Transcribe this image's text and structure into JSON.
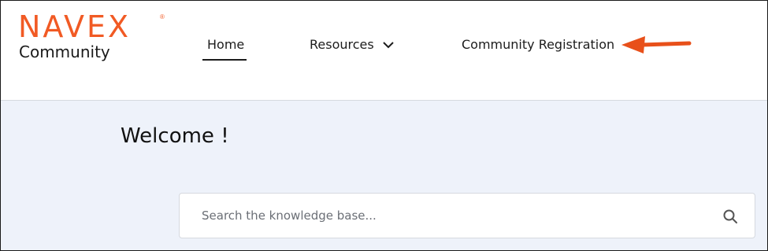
{
  "brand": {
    "logo_text": "NAVEX",
    "logo_mark": "®",
    "subtitle": "Community",
    "accent_color": "#f15a24"
  },
  "nav": {
    "items": [
      {
        "label": "Home",
        "active": true
      },
      {
        "label": "Resources",
        "has_dropdown": true,
        "icon": "chevron-down-icon"
      },
      {
        "label": "Community Registration"
      }
    ],
    "callout_icon": "arrow-left-icon"
  },
  "main": {
    "welcome_text": "Welcome !",
    "search": {
      "placeholder": "Search the knowledge base...",
      "value": "",
      "icon": "search-icon"
    },
    "background_color": "#eef2fa"
  }
}
